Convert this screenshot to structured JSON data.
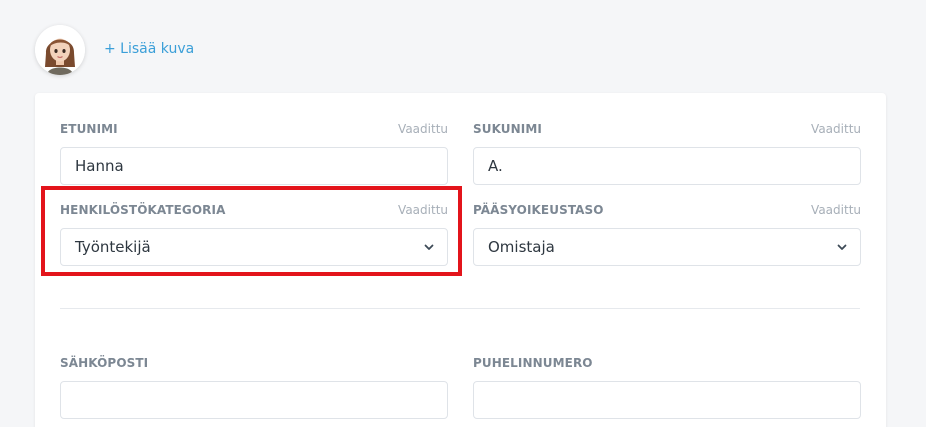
{
  "profile": {
    "add_photo_label": "+ Lisää kuva"
  },
  "form": {
    "first_name": {
      "label": "ETUNIMI",
      "required": "Vaadittu",
      "value": "Hanna"
    },
    "last_name": {
      "label": "SUKUNIMI",
      "required": "Vaadittu",
      "value": "A."
    },
    "staff_category": {
      "label": "HENKILÖSTÖKATEGORIA",
      "required": "Vaadittu",
      "value": "Työntekijä"
    },
    "access_level": {
      "label": "PÄÄSYOIKEUSTASO",
      "required": "Vaadittu",
      "value": "Omistaja"
    },
    "email": {
      "label": "SÄHKÖPOSTI",
      "value": ""
    },
    "phone": {
      "label": "PUHELINNUMERO",
      "value": ""
    }
  },
  "colors": {
    "accent": "#3b9fd8",
    "highlight": "#e3141b",
    "label": "#7c8793"
  },
  "icons": {
    "select_chevron": "chevron-down-icon",
    "avatar": "avatar"
  }
}
